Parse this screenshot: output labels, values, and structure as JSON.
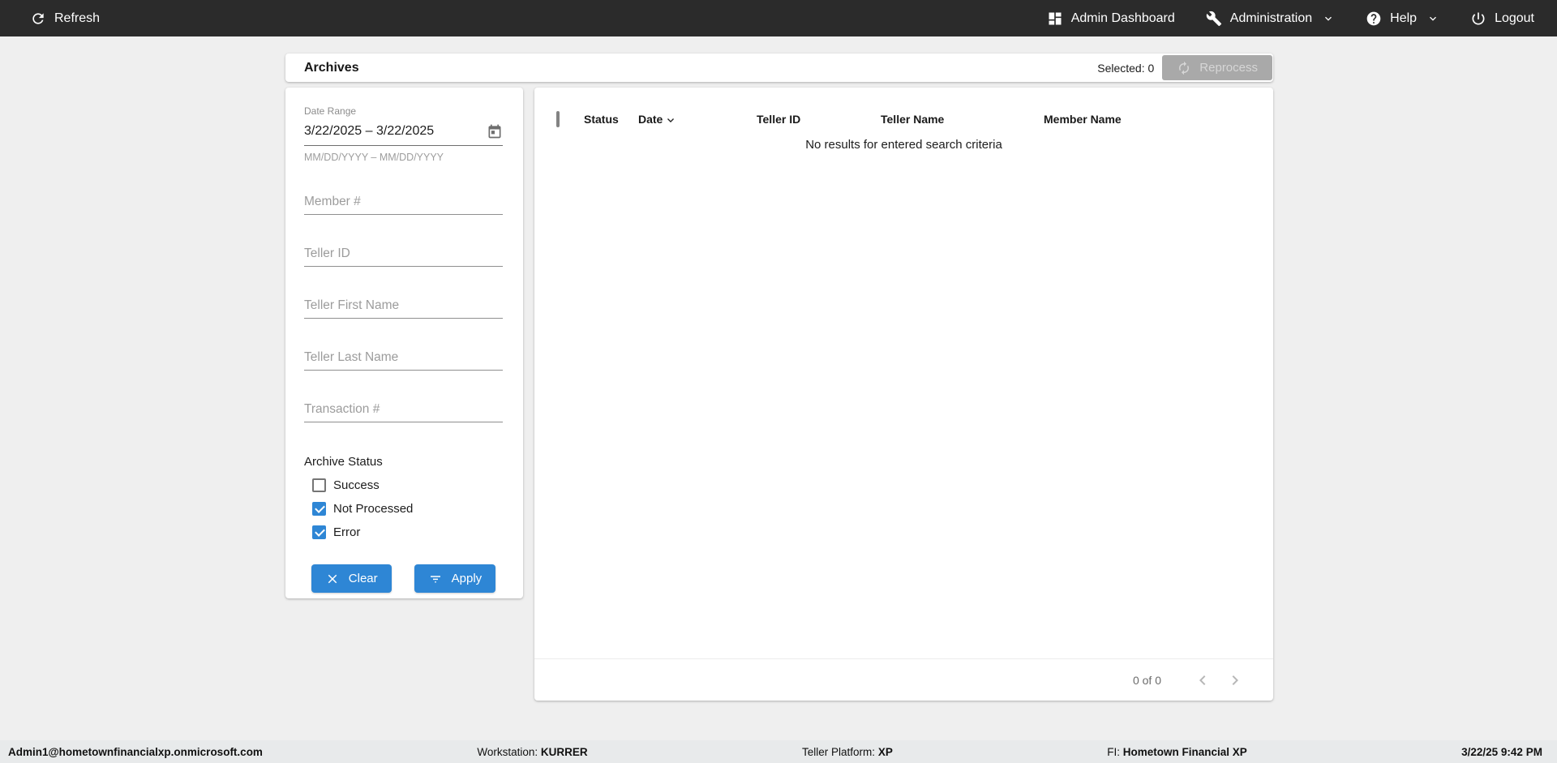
{
  "topbar": {
    "refresh": "Refresh",
    "admin_dashboard": "Admin Dashboard",
    "administration": "Administration",
    "help": "Help",
    "logout": "Logout"
  },
  "toolbar": {
    "title": "Archives",
    "selected_label": "Selected: 0",
    "reprocess_label": "Reprocess"
  },
  "filters": {
    "date_range": {
      "label": "Date Range",
      "value": "3/22/2025 – 3/22/2025",
      "hint": "MM/DD/YYYY – MM/DD/YYYY"
    },
    "fields": [
      {
        "placeholder": "Member #"
      },
      {
        "placeholder": "Teller ID"
      },
      {
        "placeholder": "Teller First Name"
      },
      {
        "placeholder": "Teller Last Name"
      },
      {
        "placeholder": "Transaction #"
      }
    ],
    "archive_status": {
      "label": "Archive Status",
      "options": [
        {
          "label": "Success",
          "checked": false
        },
        {
          "label": "Not Processed",
          "checked": true
        },
        {
          "label": "Error",
          "checked": true
        }
      ]
    },
    "clear_label": "Clear",
    "apply_label": "Apply"
  },
  "table": {
    "columns": [
      "Status",
      "Date",
      "Teller ID",
      "Teller Name",
      "Member Name"
    ],
    "sort_column": "Date",
    "sort_direction": "desc",
    "empty_message": "No results for entered search criteria",
    "rows": []
  },
  "paginator": {
    "range_label": "0 of 0"
  },
  "footer": {
    "user": "Admin1@hometownfinancialxp.onmicrosoft.com",
    "workstation_label": "Workstation:",
    "workstation_value": "KURRER",
    "platform_label": "Teller Platform:",
    "platform_value": "XP",
    "fi_label": "FI:",
    "fi_value": "Hometown Financial XP",
    "datetime": "3/22/25 9:42 PM"
  },
  "colors": {
    "accent_blue": "#2e86d5",
    "topbar_bg": "#2b2b2b",
    "disabled_button_bg": "#a9a9a9",
    "page_bg": "#efefef"
  }
}
